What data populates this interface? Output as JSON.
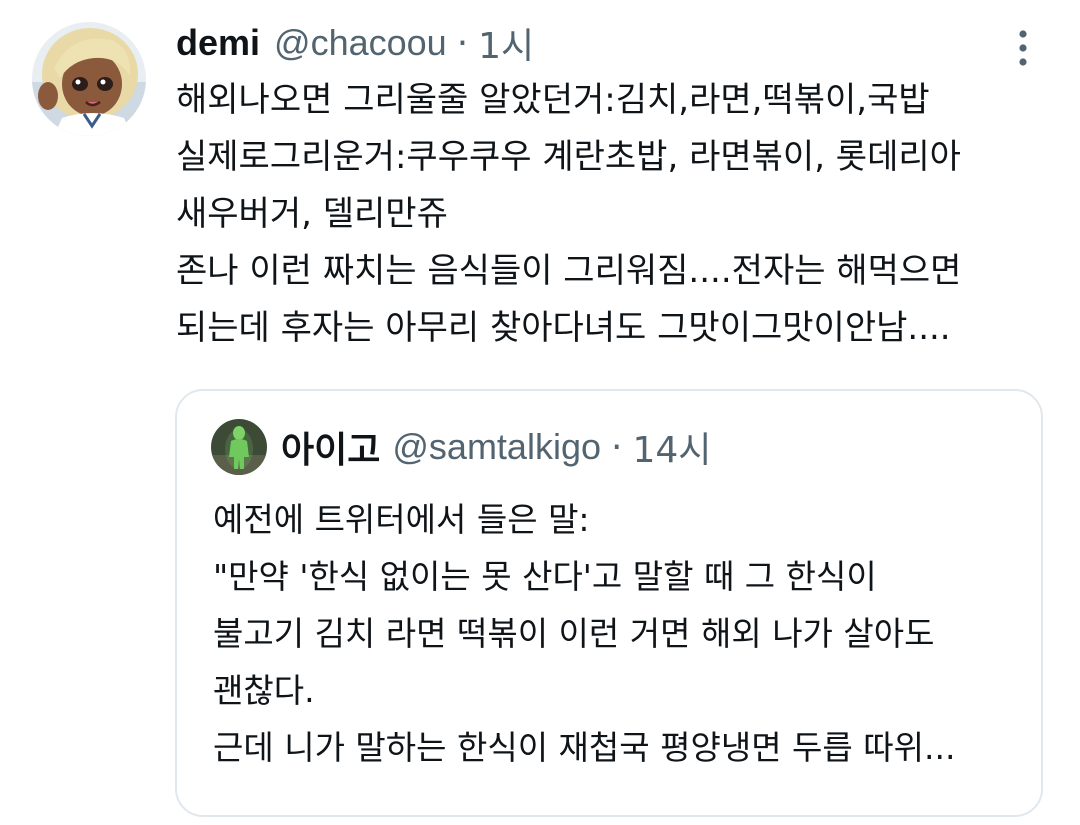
{
  "tweet": {
    "display_name": "demi",
    "handle": "@chacoou",
    "separator": "·",
    "time": "1시",
    "more_icon": "vertical-dots-icon",
    "lines": [
      "해외나오면 그리울줄 알았던거:김치,라면,떡볶이,국밥",
      "실제로그리운거:쿠우쿠우 계란초밥, 라면볶이, 롯데리아",
      "새우버거, 델리만쥬",
      "존나 이런 짜치는 음식들이 그리워짐....전자는 해먹으면",
      "되는데 후자는 아무리 찾아다녀도 그맛이그맛이안남...."
    ]
  },
  "quoted": {
    "display_name": "아이고",
    "handle": "@samtalkigo",
    "separator": "·",
    "time": "14시",
    "lines": [
      "예전에 트위터에서 들은 말:",
      "\"만약 '한식 없이는 못 산다'고 말할 때 그 한식이",
      "불고기 김치 라면 떡볶이 이런 거면 해외 나가 살아도",
      "괜찮다.",
      "근데 니가 말하는 한식이 재첩국 평양냉면 두릅 따위..."
    ]
  },
  "colors": {
    "text": "#0f1419",
    "secondary": "#536471",
    "border": "#e1e8ed"
  }
}
